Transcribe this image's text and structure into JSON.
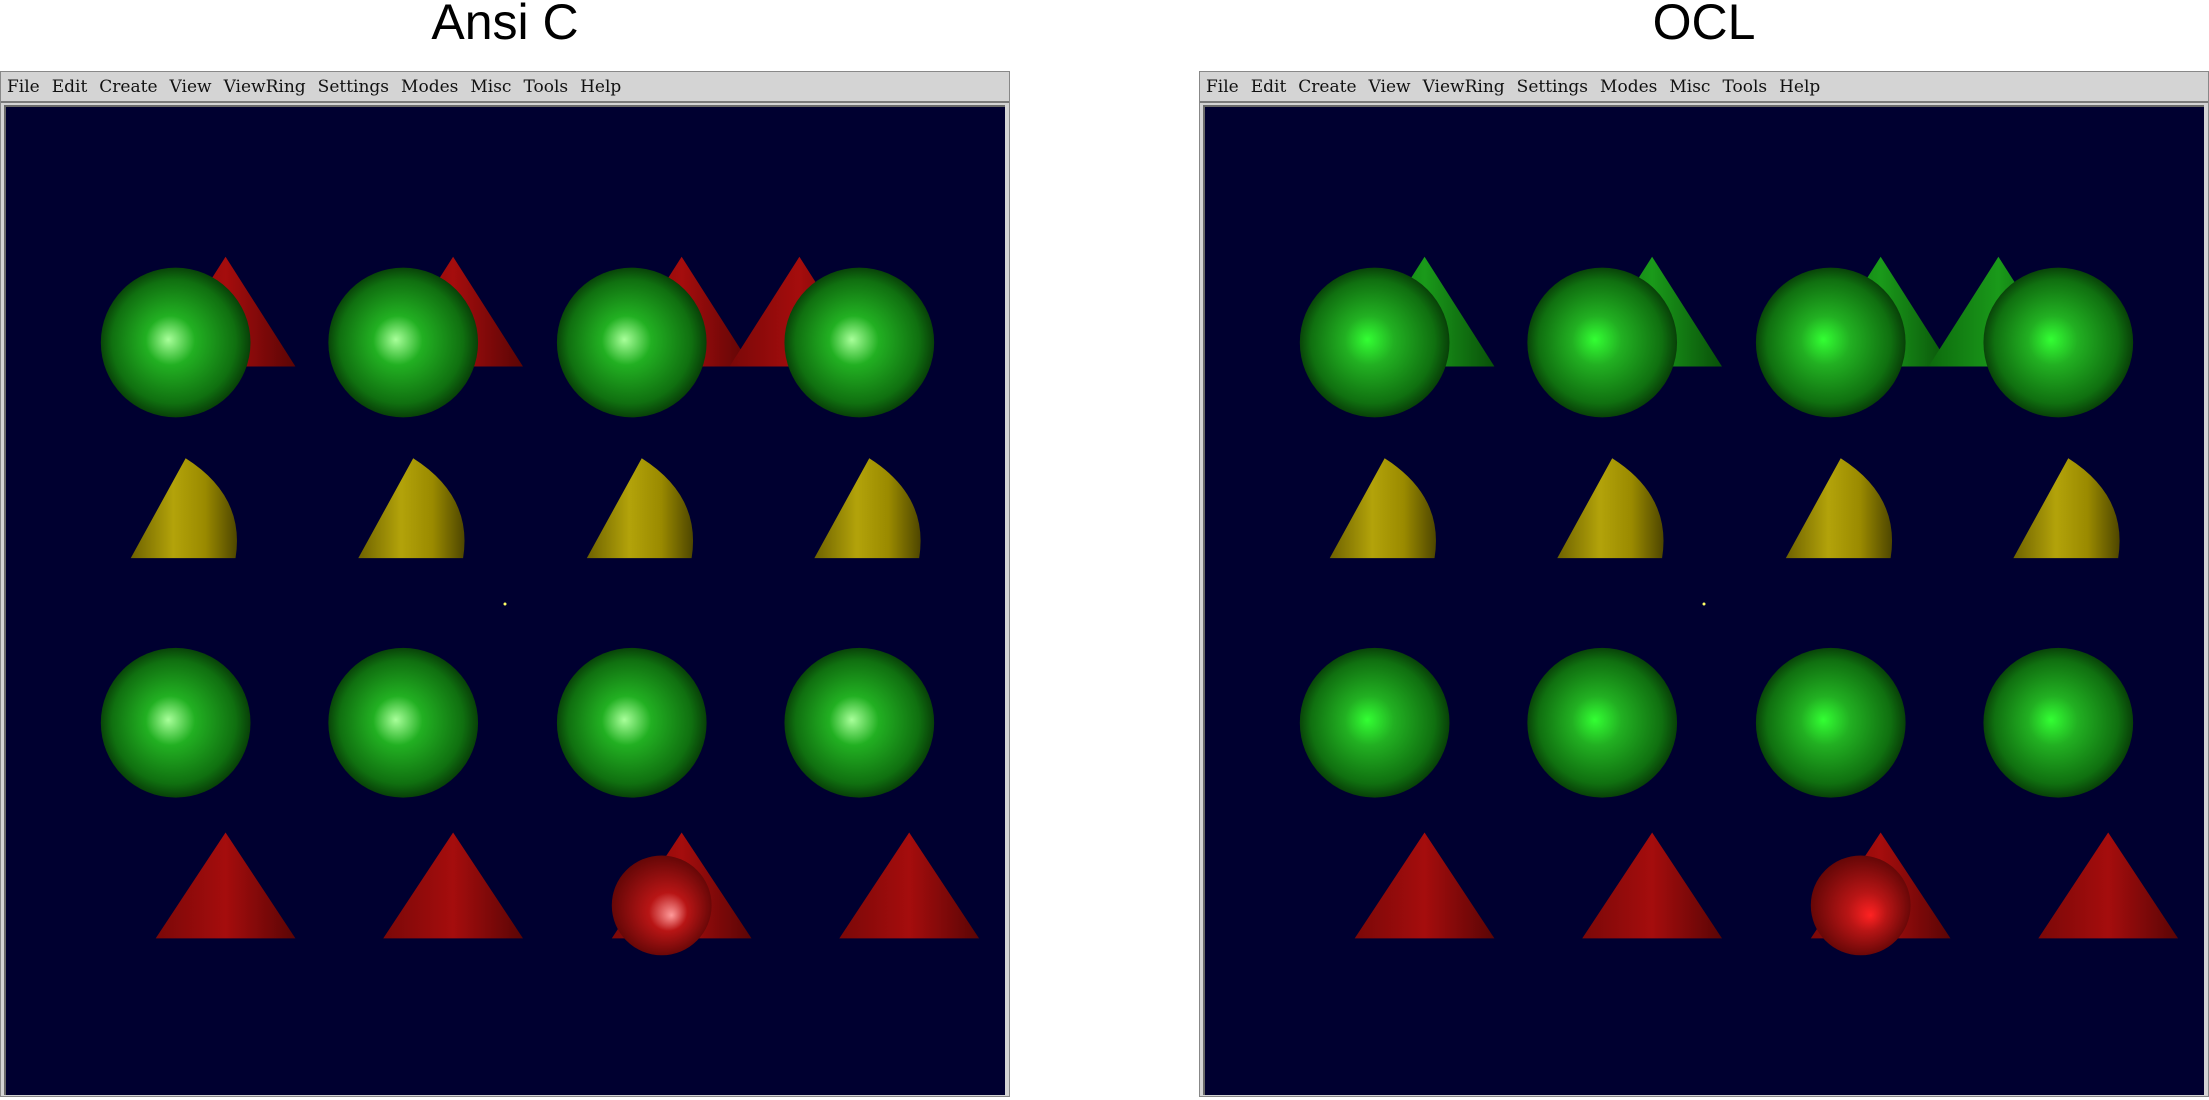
{
  "panels": [
    {
      "title": "Ansi C",
      "menu": [
        "File",
        "Edit",
        "Create",
        "View",
        "ViewRing",
        "Settings",
        "Modes",
        "Misc",
        "Tools",
        "Help"
      ],
      "colors": {
        "background": "#000030",
        "sphere": "#1f9d1f",
        "sphere_highlight": "#a8ff9a",
        "cone_yellow": "#b3a30a",
        "cone_red": "#a50d0d",
        "red_highlight": "#ff9a9a"
      }
    },
    {
      "title": "OCL",
      "menu": [
        "File",
        "Edit",
        "Create",
        "View",
        "ViewRing",
        "Settings",
        "Modes",
        "Misc",
        "Tools",
        "Help"
      ],
      "colors": {
        "background": "#000030",
        "sphere": "#1f9d1f",
        "sphere_highlight": "#33ff33",
        "cone_yellow": "#b3a30a",
        "cone_red": "#a50d0d",
        "red_highlight": "#ff2222"
      }
    }
  ]
}
